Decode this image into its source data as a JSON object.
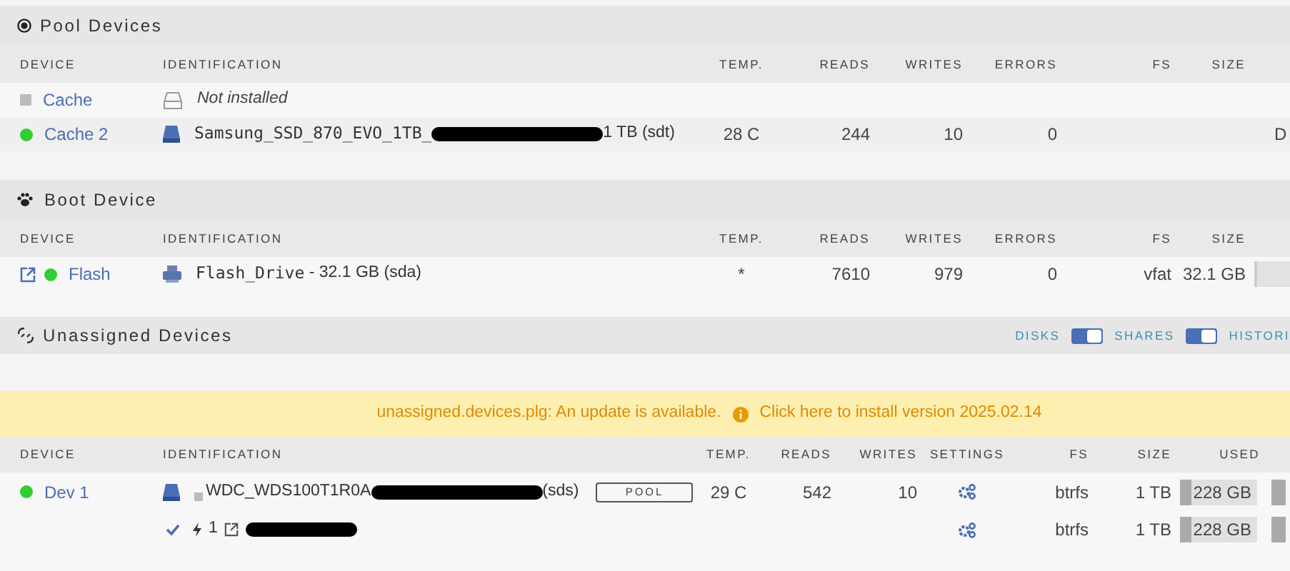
{
  "pool_devices": {
    "title": "Pool Devices",
    "columns": [
      "DEVICE",
      "IDENTIFICATION",
      "TEMP.",
      "READS",
      "WRITES",
      "ERRORS",
      "FS",
      "SIZE"
    ],
    "rows": [
      {
        "color": "#bbbbbb",
        "device": "Cache",
        "installed": false,
        "kind": "empty",
        "ident_name": "Not installed"
      },
      {
        "color": "#33cc33",
        "device": "Cache 2",
        "installed": true,
        "kind": "ssd",
        "ident_name": "Samsung_SSD_870_EVO_1TB_",
        "redacted": true,
        "ident_detail": "1 TB (sdt)",
        "temp": "28 C",
        "reads": "244",
        "writes": "10",
        "errors": "0",
        "column_9": "D"
      }
    ]
  },
  "boot_device": {
    "title": "Boot Device",
    "columns": [
      "DEVICE",
      "IDENTIFICATION",
      "TEMP.",
      "READS",
      "WRITES",
      "ERRORS",
      "FS",
      "SIZE"
    ],
    "rows": [
      {
        "color": "#33cc33",
        "device": "Flash",
        "external_link": true,
        "installed": true,
        "kind": "usb",
        "ident_name": "Flash_Drive",
        "ident_detail": " - 32.1 GB (sda)",
        "temp": "*",
        "reads": "7610",
        "writes": "979",
        "errors": "0",
        "fs": "vfat",
        "size": "32.1 GB",
        "bar": true
      }
    ]
  },
  "unassigned_devices": {
    "title": "Unassigned Devices",
    "toggles": [
      {
        "label": "DISKS",
        "on": true
      },
      {
        "label": "SHARES",
        "on": true
      },
      {
        "label": "HISTORI"
      }
    ],
    "notice": {
      "message": "unassigned.devices.plg: An update is available.",
      "link": "Click here to install version 2025.02.14"
    },
    "columns": [
      "DEVICE",
      "IDENTIFICATION",
      "TEMP.",
      "READS",
      "WRITES",
      "SETTINGS",
      "FS",
      "SIZE",
      "USED"
    ],
    "rows": [
      {
        "kind": "disk",
        "color": "#33cc33",
        "device": "Dev 1",
        "ident_name": "WDC_WDS100T1R0A",
        "redacted": true,
        "ident_detail": "(sds)",
        "action": "POOL",
        "temp": "29 C",
        "reads": "542",
        "writes": "10",
        "fs": "btrfs",
        "size": "1 TB",
        "used": "228 GB"
      },
      {
        "kind": "partition",
        "mounted": true,
        "partition": "1",
        "redacted": true,
        "fs": "btrfs",
        "size": "1 TB",
        "used": "228 GB"
      }
    ]
  }
}
